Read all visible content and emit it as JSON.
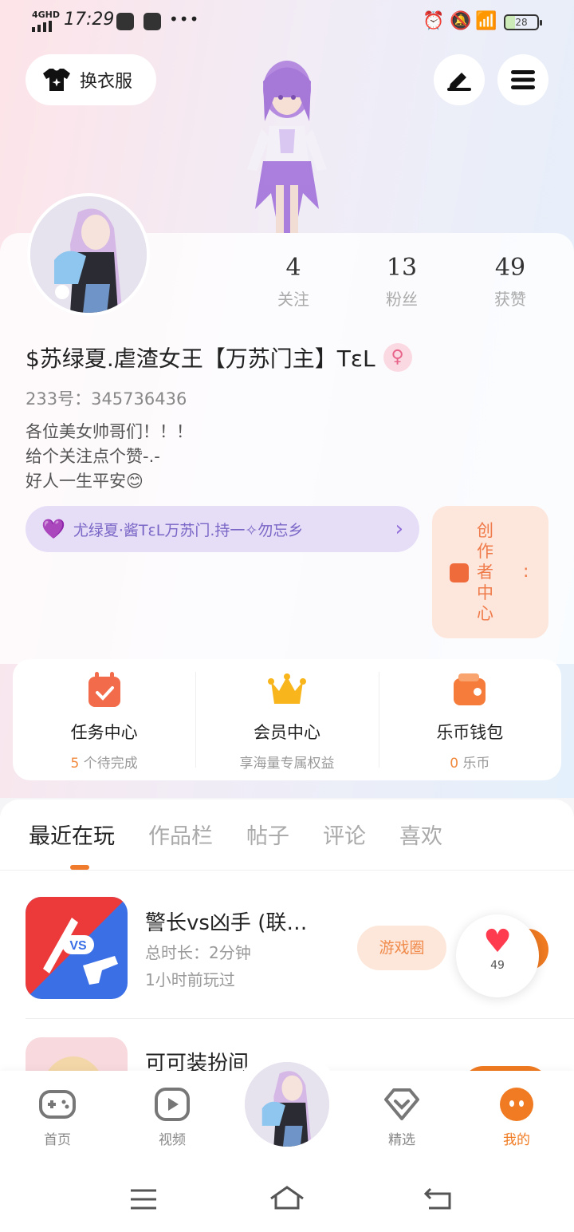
{
  "status_bar": {
    "network": "4GHD",
    "time": "17:29",
    "more": "•••",
    "battery": "28"
  },
  "top": {
    "outfit_label": "换衣服"
  },
  "profile": {
    "stats": [
      {
        "value": "4",
        "label": "关注"
      },
      {
        "value": "13",
        "label": "粉丝"
      },
      {
        "value": "49",
        "label": "获赞"
      }
    ],
    "nickname": "$苏绿夏.虐渣女王【万苏门主】TεL",
    "gender_symbol": "♀",
    "uid": "233号：345736436",
    "bio": [
      "各位美女帅哥们！！！",
      "给个关注点个赞-.-",
      "好人一生平安😊"
    ],
    "club": "尤绿夏·酱TεL万苏门.持一✧勿忘乡",
    "creator": "创作者中心",
    "creator_colon": ":"
  },
  "quick_actions": [
    {
      "title": "任务中心",
      "sub_highlight": "5",
      "sub": "个待完成"
    },
    {
      "title": "会员中心",
      "sub_highlight": "",
      "sub": "享海量专属权益"
    },
    {
      "title": "乐币钱包",
      "sub_highlight": "0",
      "sub": "乐币"
    }
  ],
  "tabs": [
    "最近在玩",
    "作品栏",
    "帖子",
    "评论",
    "喜欢"
  ],
  "games": [
    {
      "name": "警长vs凶手 (联…",
      "playtime": "总时长：2分钟",
      "last_played": "1小时前玩过",
      "chip": "游戏圈"
    },
    {
      "name": "可可装扮间",
      "playtime": "",
      "last_played": "",
      "chip": ""
    }
  ],
  "like_count": "49",
  "bottom_nav": [
    {
      "label": "首页"
    },
    {
      "label": "视频"
    },
    {
      "label": "精选"
    },
    {
      "label": "我的"
    }
  ],
  "colors": {
    "accent": "#f07b22",
    "purple": "#8e6ad8",
    "pink": "#ff3b4f"
  }
}
